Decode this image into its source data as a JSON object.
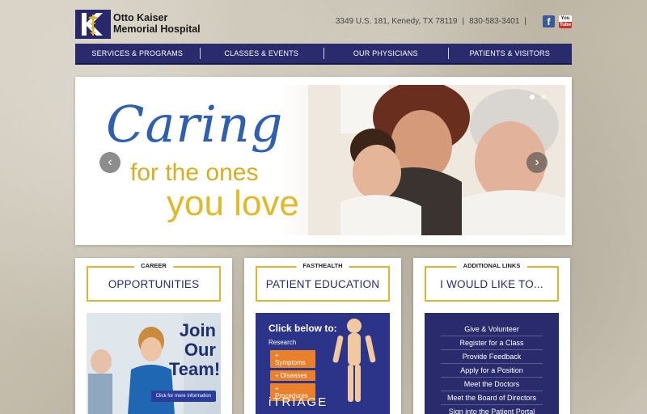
{
  "header": {
    "logo_line1": "Otto Kaiser",
    "logo_line2": "Memorial Hospital",
    "address": "3349 U.S. 181, Kenedy, TX 78119",
    "phone": "830-583-3401",
    "separator": "|",
    "facebook_letter": "f",
    "youtube_you": "You",
    "youtube_tube": "Tube"
  },
  "nav": {
    "items": [
      {
        "label": "SERVICES & PROGRAMS"
      },
      {
        "label": "CLASSES & EVENTS"
      },
      {
        "label": "OUR PHYSICIANS"
      },
      {
        "label": "PATIENTS & VISITORS"
      }
    ]
  },
  "banner": {
    "slogan_line1": "Caring",
    "slogan_line2": "for the ones",
    "slogan_line3": "you love",
    "prev_arrow": "‹",
    "next_arrow": "›"
  },
  "cards": {
    "career": {
      "kicker": "CAREER",
      "title": "OPPORTUNITIES",
      "image_heading": "Join Our Team!",
      "image_button": "Click for more information"
    },
    "fasthealth": {
      "kicker": "FASTHEALTH",
      "title": "PATIENT EDUCATION",
      "click_below": "Click below to:",
      "research": "Research",
      "items": [
        "+ Symptoms",
        "+ Diseases",
        "+ Procedures"
      ],
      "brand": "iTRIAGE"
    },
    "links": {
      "kicker": "ADDITIONAL LINKS",
      "title": "I WOULD LIKE TO...",
      "items": [
        "Give & Volunteer",
        "Register for a Class",
        "Provide Feedback",
        "Apply for a Position",
        "Meet the Doctors",
        "Meet the Board of Directors",
        "Sign into the Patient Portal"
      ]
    }
  },
  "colors": {
    "navy": "#2a2b6c",
    "gold": "#e1b52f",
    "slogan_blue": "#2e5fb0",
    "slogan_gold": "#d6ae24",
    "orange": "#e8802c"
  }
}
